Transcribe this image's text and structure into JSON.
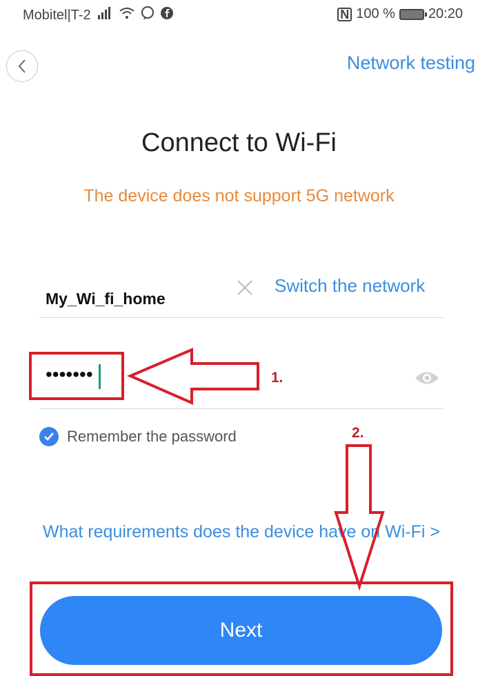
{
  "status_bar": {
    "carrier": "Mobitel|T-2",
    "battery": "100 %",
    "time": "20:20"
  },
  "header": {
    "back_icon": "chevron-left-icon",
    "network_testing": "Network testing"
  },
  "title": "Connect to Wi-Fi",
  "warning": "The device does not support 5G network",
  "ssid": {
    "value": "My_Wi_fi_home",
    "switch_label": "Switch the network"
  },
  "password": {
    "value": "•••••••"
  },
  "remember": {
    "checked": true,
    "label": "Remember the password"
  },
  "requirements_link": "What requirements does the device have on Wi-Fi >",
  "next_button": "Next",
  "annotations": {
    "step1": "1.",
    "step2": "2."
  },
  "colors": {
    "accent_blue": "#3b8ede",
    "button_blue": "#2f86f6",
    "warning_orange": "#e88a3a",
    "annotation_red": "#d6202b"
  }
}
